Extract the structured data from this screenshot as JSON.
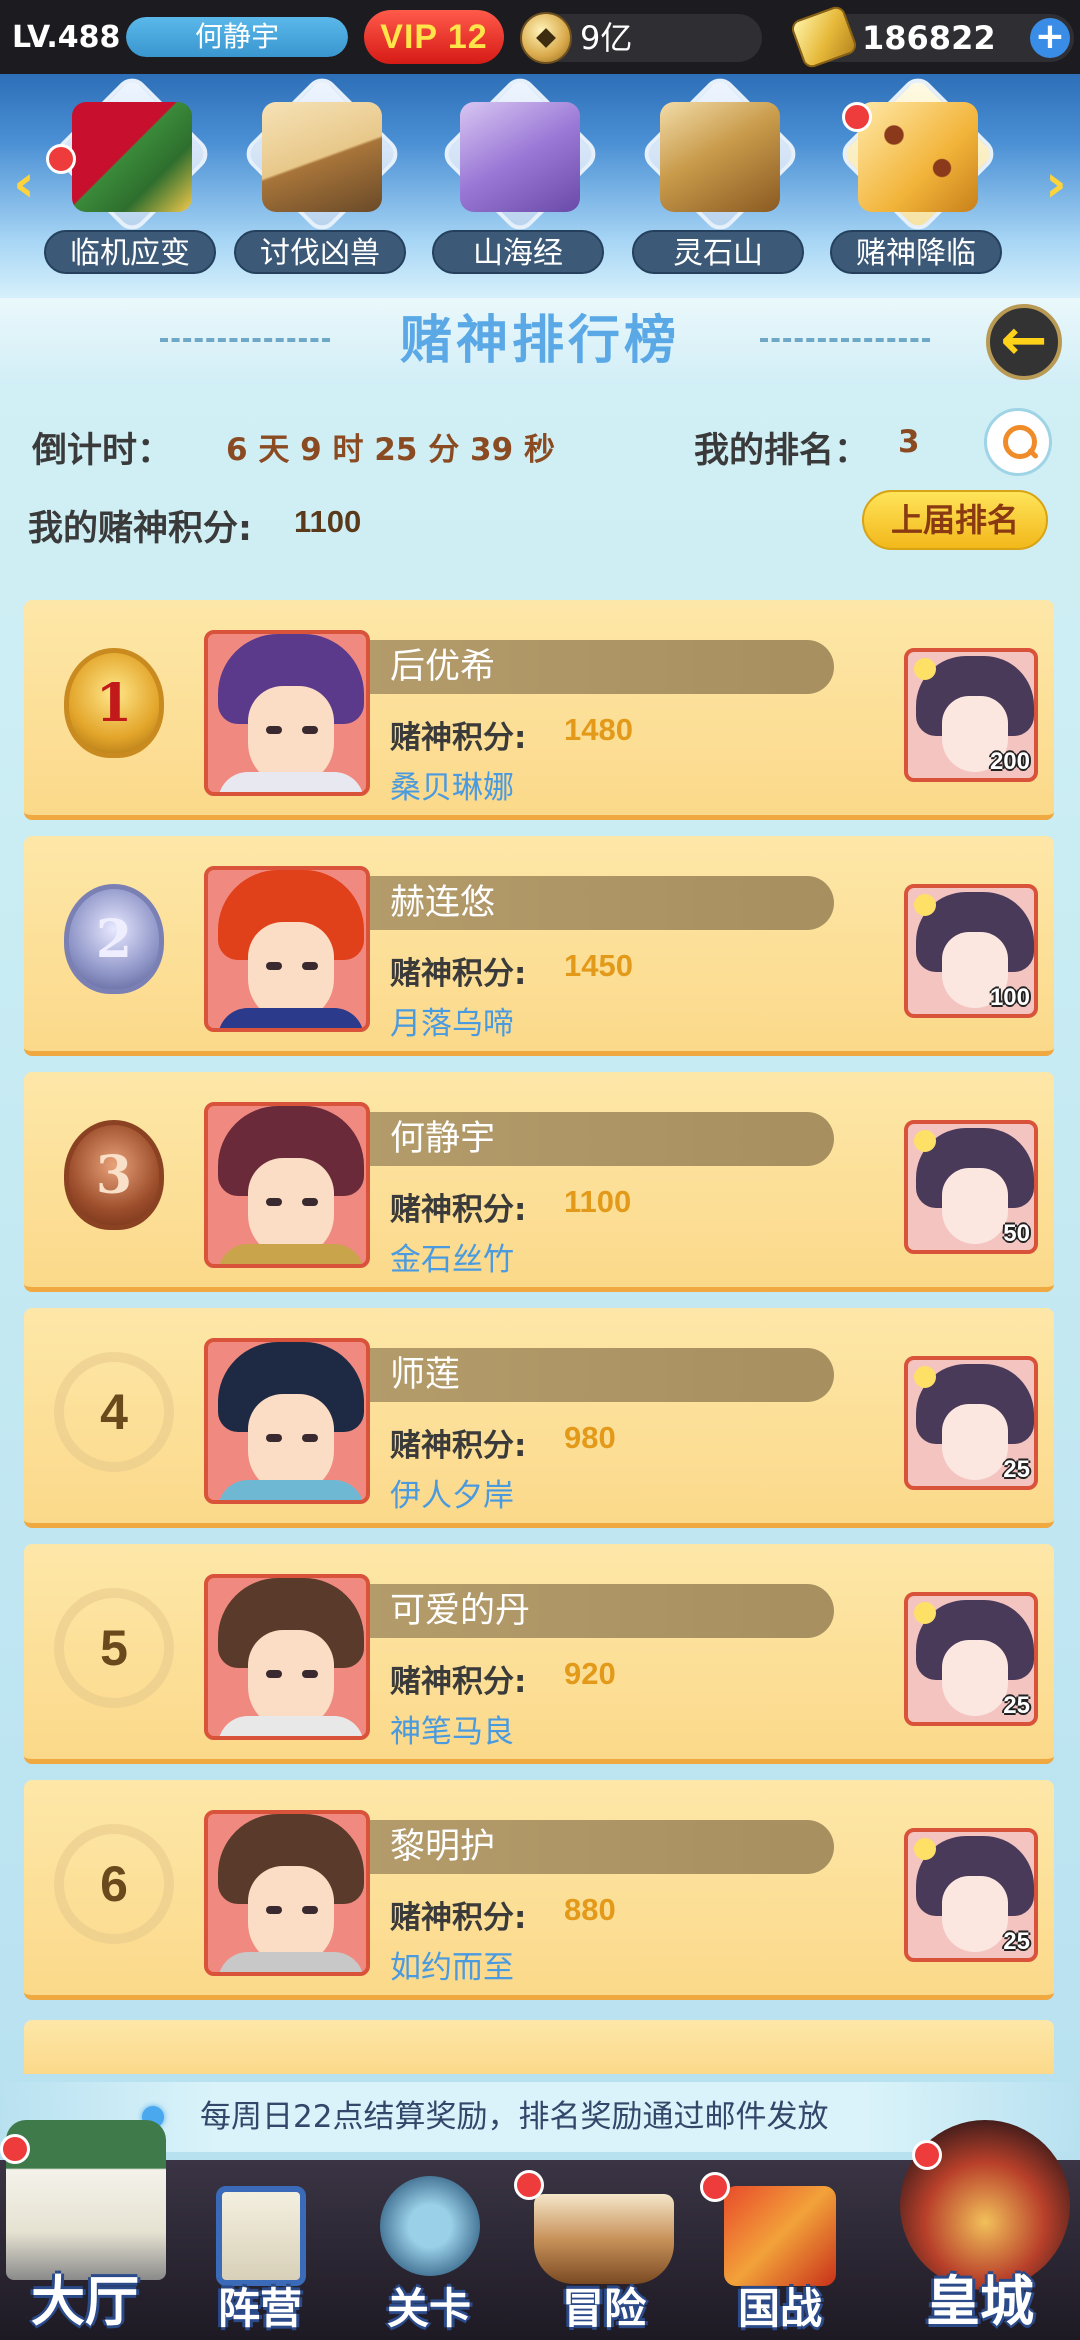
{
  "topbar": {
    "level": "LV.488",
    "player_name": "何静宇",
    "vip": "VIP 12",
    "coins": "9亿",
    "gold": "186822",
    "add_icon": "plus-icon"
  },
  "events": [
    {
      "label": "临机应变",
      "icon": "banner-scroll-icon",
      "red_dot": true
    },
    {
      "label": "讨伐凶兽",
      "icon": "book-spear-icon",
      "red_dot": false
    },
    {
      "label": "山海经",
      "icon": "purple-scroll-icon",
      "red_dot": false
    },
    {
      "label": "灵石山",
      "icon": "scroll-rolls-icon",
      "red_dot": false
    },
    {
      "label": "赌神降临",
      "icon": "dice-icon",
      "red_dot": true
    }
  ],
  "page": {
    "title": "赌神排行榜",
    "back_icon": "back-arrow-icon"
  },
  "info": {
    "countdown_label": "倒计时：",
    "countdown_value": "6 天 9 时 25 分 39 秒",
    "my_rank_label": "我的排名：",
    "my_rank_value": "3",
    "my_score_label": "我的赌神积分:",
    "my_score_value": "1100",
    "last_rank_button": "上届排名"
  },
  "score_label": "赌神积分:",
  "rankings": [
    {
      "rank": "1",
      "name": "后优希",
      "score": "1480",
      "server": "桑贝琳娜",
      "reward_qty": "200",
      "hair": "#5b3a8c",
      "outfit": "#e8e8f0"
    },
    {
      "rank": "2",
      "name": "赫连悠",
      "score": "1450",
      "server": "月落乌啼",
      "reward_qty": "100",
      "hair": "#e0401a",
      "outfit": "#2b3a8a"
    },
    {
      "rank": "3",
      "name": "何静宇",
      "score": "1100",
      "server": "金石丝竹",
      "reward_qty": "50",
      "hair": "#6a2a3a",
      "outfit": "#c9a44a"
    },
    {
      "rank": "4",
      "name": "师莲",
      "score": "980",
      "server": "伊人夕岸",
      "reward_qty": "25",
      "hair": "#1e2a44",
      "outfit": "#6fb8d4"
    },
    {
      "rank": "5",
      "name": "可爱的丹",
      "score": "920",
      "server": "神笔马良",
      "reward_qty": "25",
      "hair": "#5a3a2a",
      "outfit": "#e8e8e8"
    },
    {
      "rank": "6",
      "name": "黎明护",
      "score": "880",
      "server": "如约而至",
      "reward_qty": "25",
      "hair": "#5a3a2a",
      "outfit": "#c8c8c8"
    }
  ],
  "notice": "每周日22点结算奖励，排名奖励通过邮件发放",
  "bottom_nav": [
    {
      "label": "大厅",
      "icon": "castle-icon",
      "red_dot": true
    },
    {
      "label": "阵营",
      "icon": "go-board-scroll-icon",
      "red_dot": false
    },
    {
      "label": "关卡",
      "icon": "crossed-swords-icon",
      "red_dot": false
    },
    {
      "label": "冒险",
      "icon": "ship-icon",
      "red_dot": true
    },
    {
      "label": "国战",
      "icon": "war-banner-icon",
      "red_dot": true
    },
    {
      "label": "皇城",
      "icon": "palace-icon",
      "red_dot": true
    }
  ]
}
